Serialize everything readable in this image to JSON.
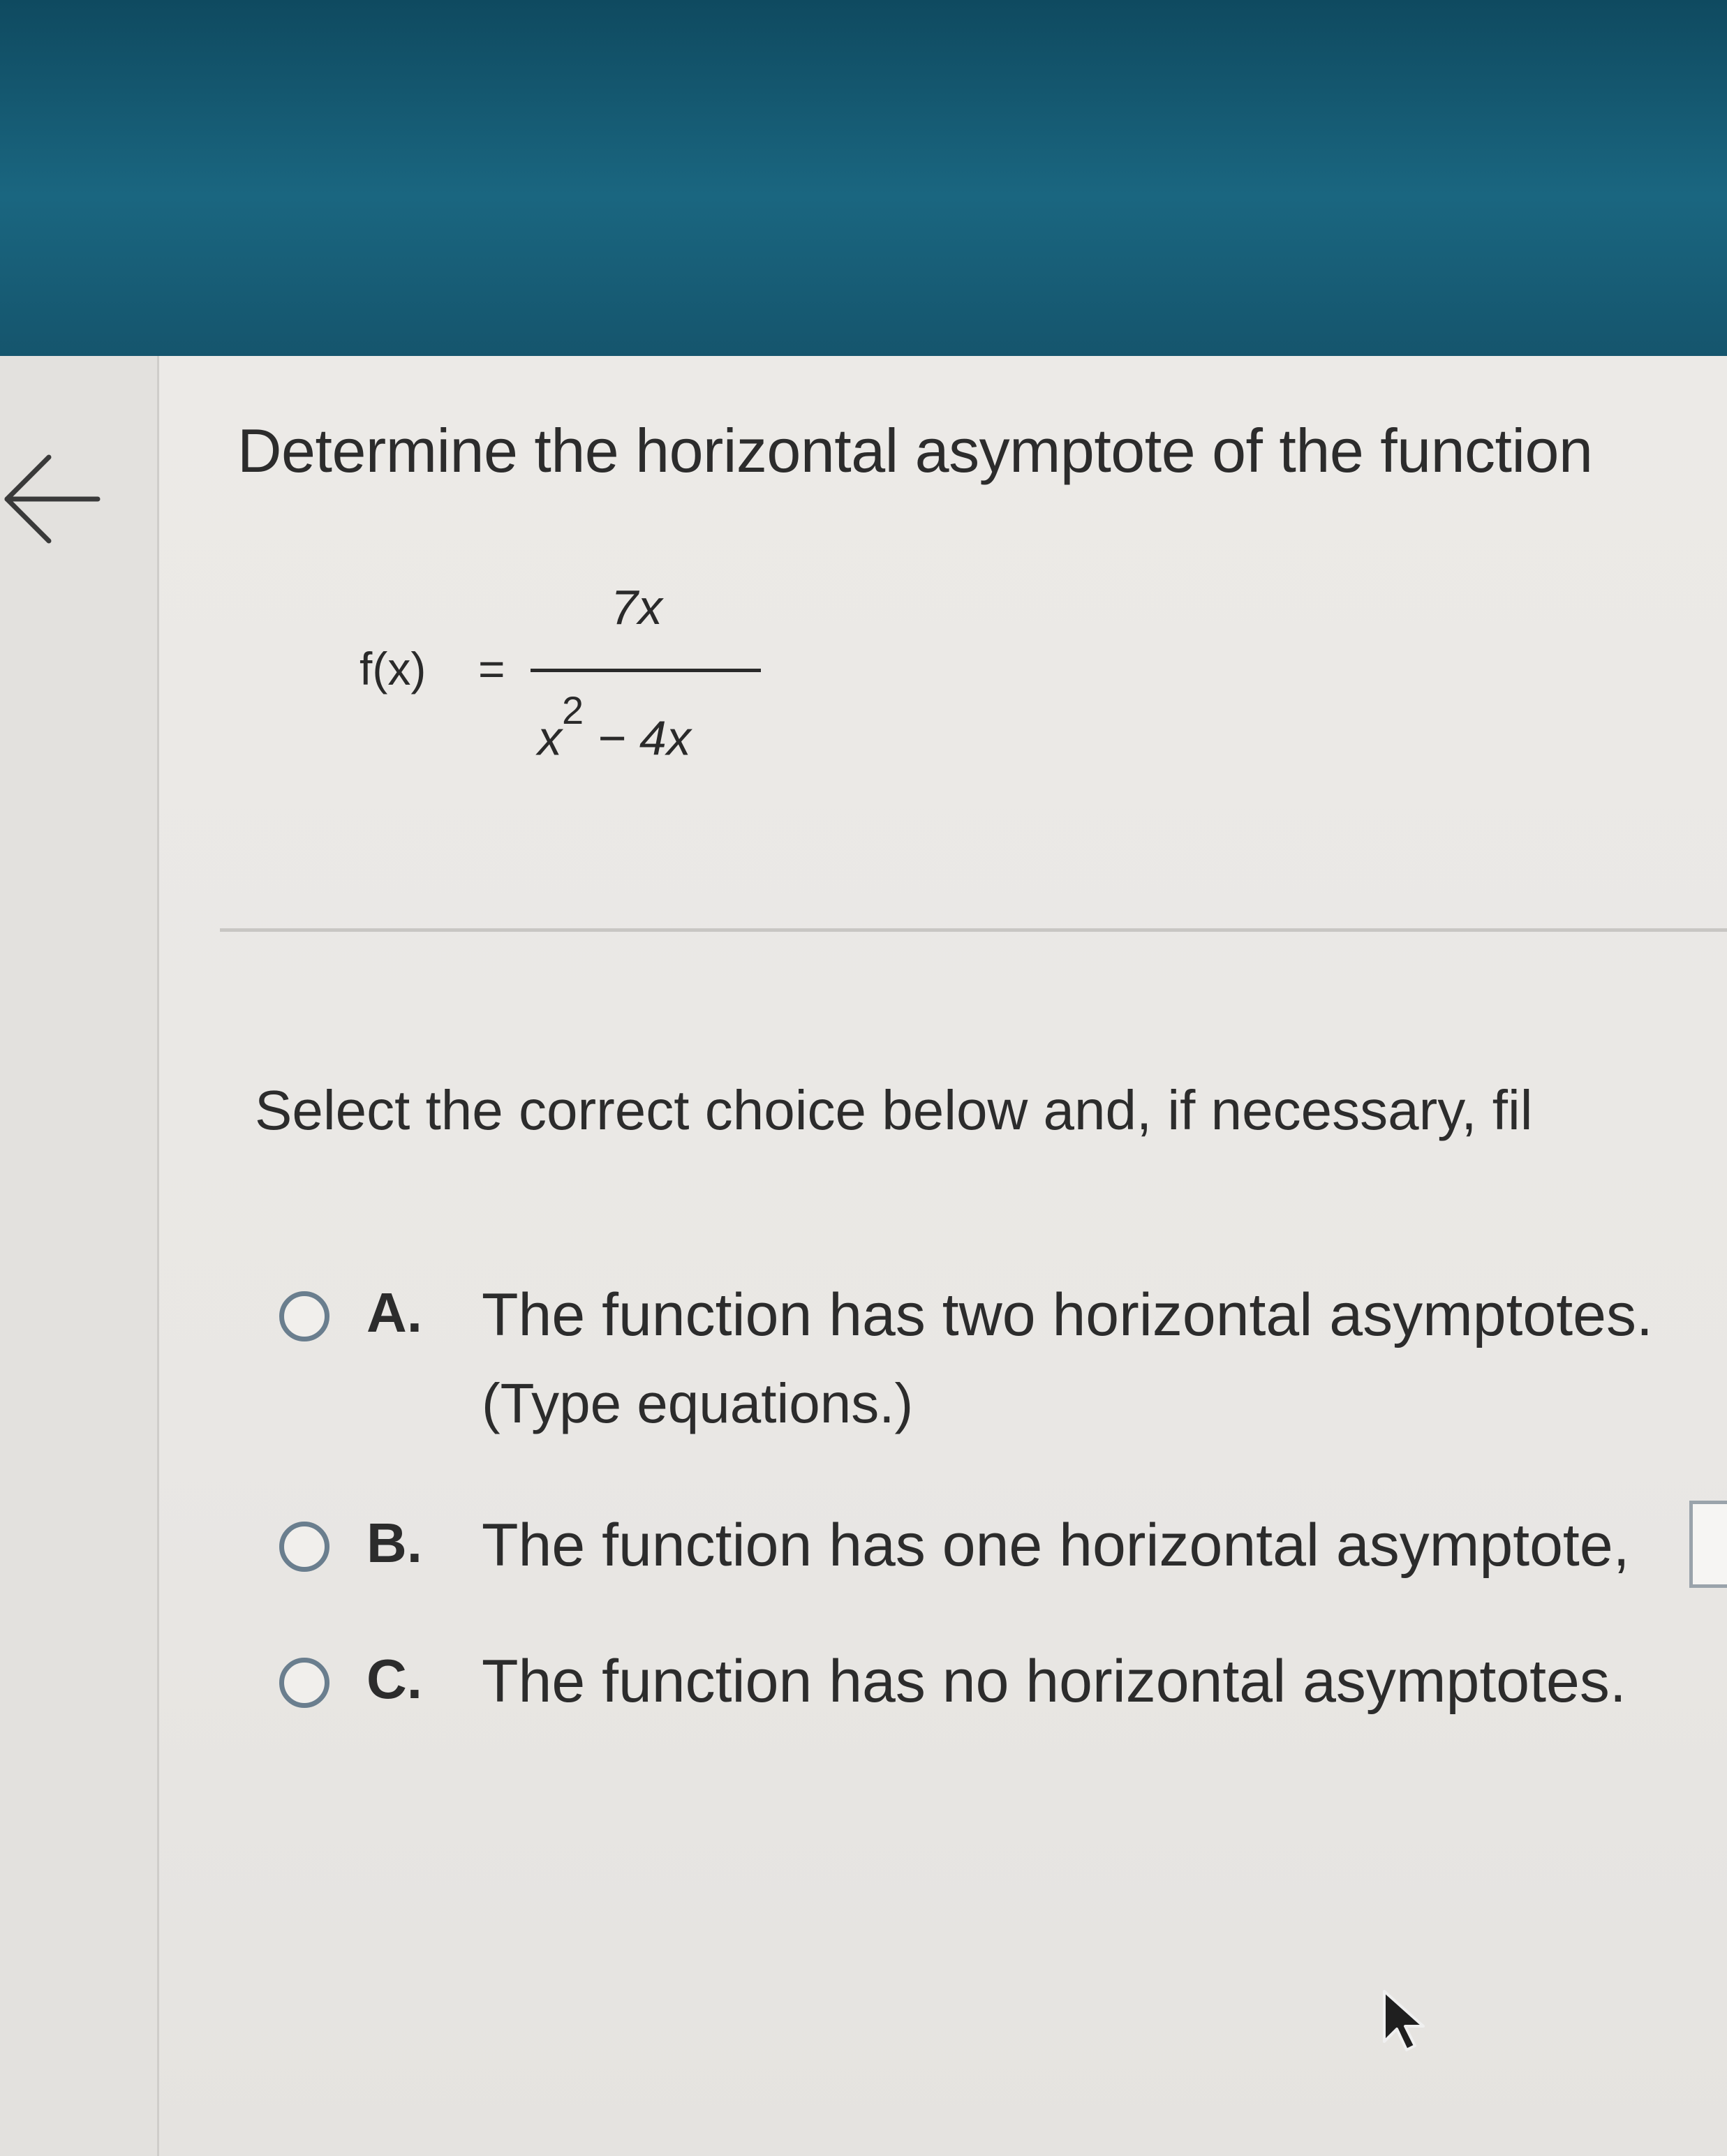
{
  "question": {
    "text": "Determine the horizontal asymptote of the function"
  },
  "equation": {
    "lhs": "f(x)",
    "equals": "=",
    "numerator": "7x",
    "denominator_base": "x",
    "denominator_exponent": "2",
    "denominator_rest": " − 4x"
  },
  "instruction": "Select the correct choice below and, if necessary, fil",
  "choices": [
    {
      "letter": "A.",
      "text": "The function has two horizontal asymptotes.",
      "subtext": "(Type equations.)"
    },
    {
      "letter": "B.",
      "text": "The function has one horizontal asymptote,"
    },
    {
      "letter": "C.",
      "text": "The function has no horizontal asymptotes."
    }
  ],
  "icons": {
    "back": "arrow-left-icon",
    "cursor": "mouse-pointer-icon"
  },
  "colors": {
    "header": "#15556d",
    "radio_border": "#6a7e8e"
  }
}
